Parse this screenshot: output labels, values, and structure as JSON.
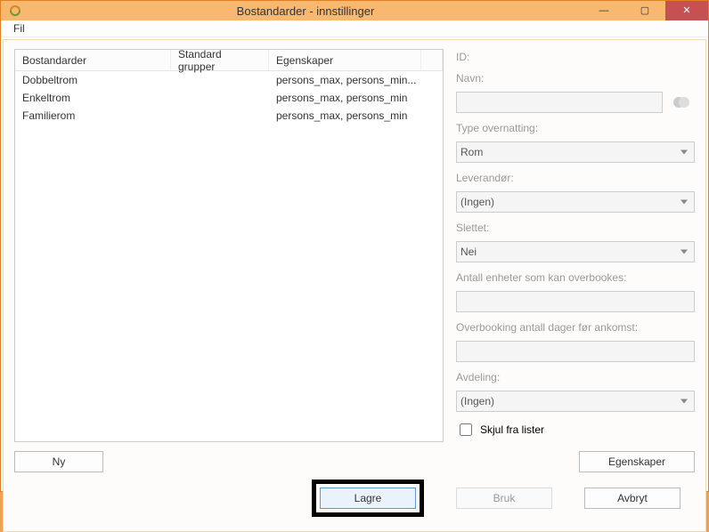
{
  "window": {
    "title": "Bostandarder - innstillinger",
    "icon": "chain-icon"
  },
  "menu": {
    "file": "Fil"
  },
  "table": {
    "headers": {
      "col1": "Bostandarder",
      "col2": "Standard grupper",
      "col3": "Egenskaper"
    },
    "rows": [
      {
        "name": "Dobbeltrom",
        "group": "",
        "props": "persons_max, persons_min..."
      },
      {
        "name": "Enkeltrom",
        "group": "",
        "props": "persons_max, persons_min"
      },
      {
        "name": "Familierom",
        "group": "",
        "props": "persons_max, persons_min"
      }
    ]
  },
  "form": {
    "id_label": "ID:",
    "id_value": "",
    "navn_label": "Navn:",
    "navn_value": "",
    "type_label": "Type overnatting:",
    "type_value": "Rom",
    "leverandor_label": "Leverandør:",
    "leverandor_value": "(Ingen)",
    "slettet_label": "Slettet:",
    "slettet_value": "Nei",
    "overbook_units_label": "Antall enheter som kan overbookes:",
    "overbook_units_value": "",
    "overbook_days_label": "Overbooking antall dager før ankomst:",
    "overbook_days_value": "",
    "avdeling_label": "Avdeling:",
    "avdeling_value": "(Ingen)",
    "skjul_label": "Skjul fra lister"
  },
  "buttons": {
    "ny": "Ny",
    "egenskaper": "Egenskaper",
    "lagre": "Lagre",
    "bruk": "Bruk",
    "avbryt": "Avbryt"
  }
}
